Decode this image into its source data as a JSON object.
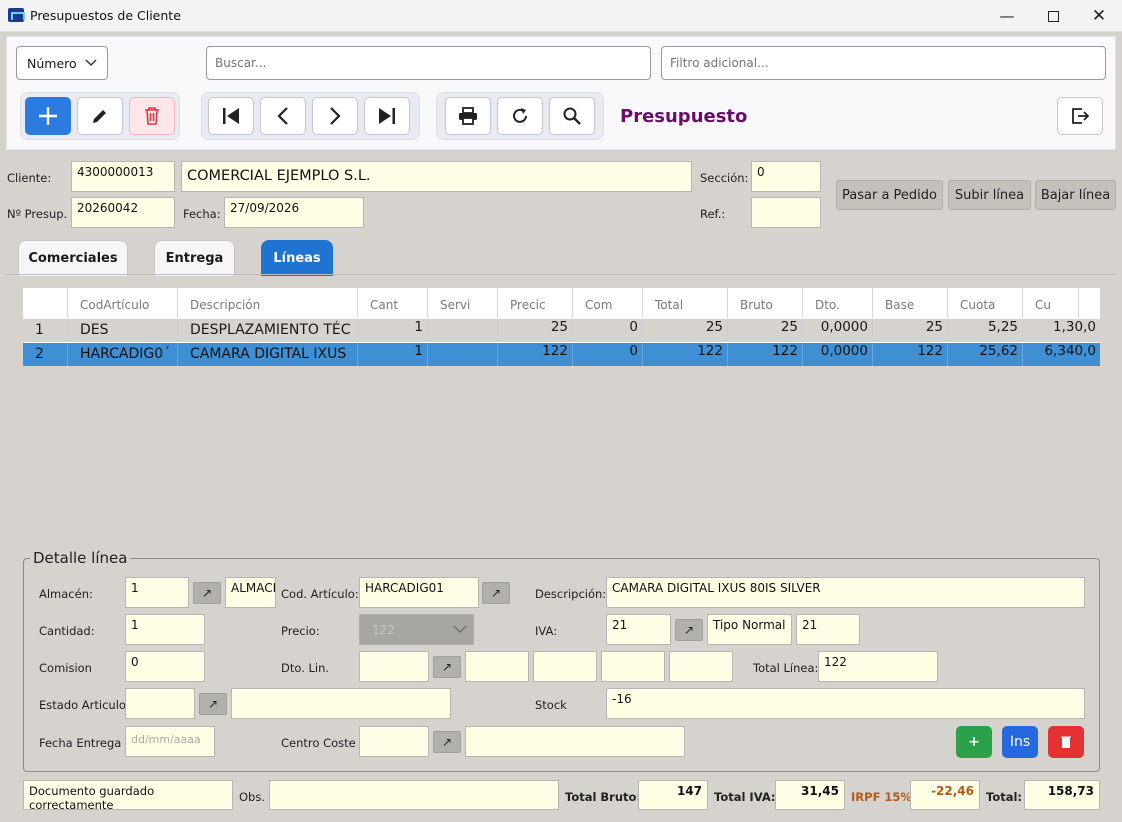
{
  "window": {
    "title": "Presupuestos de Cliente"
  },
  "toolbar": {
    "search_field": "Número",
    "search_placeholder": "Buscar...",
    "filter_placeholder": "Filtro adicional...",
    "mode_title": "Presupuesto"
  },
  "header": {
    "cliente_label": "Cliente:",
    "cliente_code": "4300000013",
    "cliente_name": "COMERCIAL EJEMPLO S.L.",
    "seccion_label": "Sección:",
    "seccion_value": "0",
    "npresup_label": "Nº Presup.",
    "npresup_value": "20260042",
    "fecha_label": "Fecha:",
    "fecha_value": "27/09/2026",
    "ref_label": "Ref.:",
    "ref_value": "",
    "buttons": {
      "pasar": "Pasar a Pedido",
      "subir": "Subir línea",
      "bajar": "Bajar línea"
    }
  },
  "tabs": [
    {
      "label": "Comerciales",
      "active": false
    },
    {
      "label": "Entrega",
      "active": false
    },
    {
      "label": "Líneas",
      "active": true
    }
  ],
  "grid": {
    "columns": [
      "",
      "CodArtículo",
      "Descripción",
      "Cant",
      "Servi",
      "Precic",
      "Com",
      "Total",
      "Bruto",
      "Dto.",
      "Base",
      "Cuota",
      "Cu"
    ],
    "rows": [
      [
        "1",
        "DES",
        "DESPLAZAMIENTO TÉC",
        "1",
        "",
        "25",
        "0",
        "25",
        "25",
        "0,0000",
        "25",
        "5,25",
        "1,30,0"
      ],
      [
        "2",
        "HARCADIG0´",
        "CAMARA DIGITAL IXUS",
        "1",
        "",
        "122",
        "0",
        "122",
        "122",
        "0,0000",
        "122",
        "25,62",
        "6,340,0"
      ]
    ],
    "selected_row": 1
  },
  "detail": {
    "legend": "Detalle línea",
    "almacen_label": "Almacén:",
    "almacen_code": "1",
    "almacen_name": "ALMACE",
    "codart_label": "Cod. Artículo:",
    "codart_value": "HARCADIG01",
    "desc_label": "Descripción:",
    "desc_value": "CAMARA DIGITAL IXUS 80IS SILVER",
    "cantidad_label": "Cantidad:",
    "cantidad_value": "1",
    "precio_label": "Precio:",
    "precio_value": "122",
    "iva_label": "IVA:",
    "iva_code": "21",
    "iva_type": "Tipo Normal",
    "iva_pct": "21",
    "comision_label": "Comision",
    "comision_value": "0",
    "dtolin_label": "Dto. Lin.",
    "total_linea_label": "Total Línea:",
    "total_linea_value": "122",
    "estado_label": "Estado Articulo",
    "stock_label": "Stock",
    "stock_value": "-16",
    "fecha_entrega_label": "Fecha Entrega",
    "fecha_entrega_placeholder": "dd/mm/aaaa",
    "centro_coste_label": "Centro Coste",
    "add_label": "+",
    "ins_label": "Ins"
  },
  "footer": {
    "status": "Documento guardado correctamente",
    "obs_label": "Obs.",
    "total_bruto_label": "Total Bruto:",
    "total_bruto": "147",
    "total_iva_label": "Total IVA:",
    "total_iva": "31,45",
    "irpf_label": "IRPF 15%",
    "irpf": "-22,46",
    "total_label": "Total:",
    "total": "158,73"
  },
  "colors": {
    "accent": "#1f74d2",
    "title_purple": "#6a0d6a",
    "field_bg": "#ffffe6",
    "irpf_orange": "#b35a1a",
    "selected_row": "#3e8fd3"
  }
}
